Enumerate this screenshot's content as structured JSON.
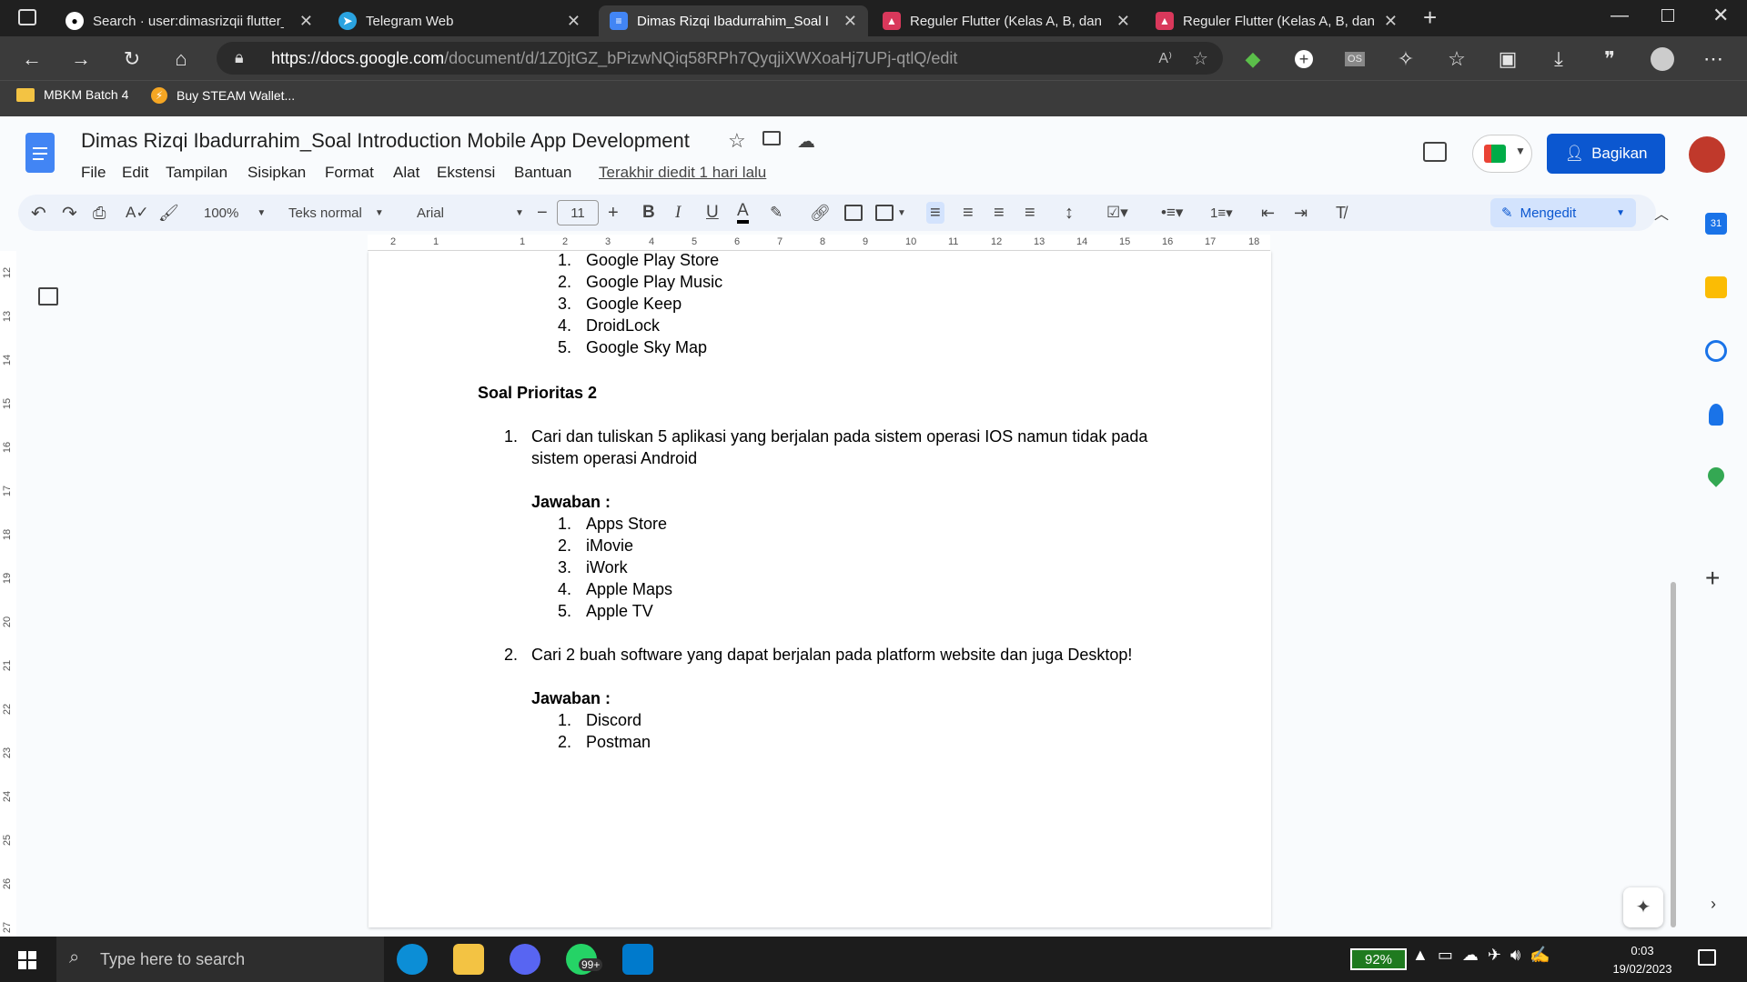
{
  "browser": {
    "tabs": [
      {
        "label": "Search · user:dimasrizqii flutter_n",
        "icon": "github-icon"
      },
      {
        "label": "Telegram Web",
        "icon": "telegram-icon"
      },
      {
        "label": "Dimas Rizqi Ibadurrahim_Soal Int",
        "icon": "docs-icon",
        "active": true
      },
      {
        "label": "Reguler Flutter (Kelas A, B, dan C",
        "icon": "forms-icon"
      },
      {
        "label": "Reguler Flutter (Kelas A, B, dan C",
        "icon": "forms-icon"
      }
    ],
    "url_domain": "https://docs.google.com",
    "url_path": "/document/d/1Z0jtGZ_bPizwNQiq58RPh7QyqjiXWXoaHj7UPj-qtlQ/edit",
    "bookmarks": [
      "MBKM Batch 4",
      "Buy STEAM Wallet..."
    ]
  },
  "doc": {
    "title": "Dimas Rizqi Ibadurrahim_Soal Introduction Mobile App Development",
    "menus": [
      "File",
      "Edit",
      "Tampilan",
      "Sisipkan",
      "Format",
      "Alat",
      "Ekstensi",
      "Bantuan"
    ],
    "last_edit": "Terakhir diedit 1 hari lalu",
    "share": "Bagikan",
    "zoom": "100%",
    "style": "Teks normal",
    "font": "Arial",
    "font_size": "11",
    "mode": "Mengedit"
  },
  "ruler_h": [
    "2",
    "1",
    "1",
    "2",
    "3",
    "4",
    "5",
    "6",
    "7",
    "8",
    "9",
    "10",
    "11",
    "12",
    "13",
    "14",
    "15",
    "16",
    "17",
    "18"
  ],
  "ruler_v": [
    "12",
    "13",
    "14",
    "15",
    "16",
    "17",
    "18",
    "19",
    "20",
    "21",
    "22",
    "23",
    "24",
    "25",
    "26",
    "27"
  ],
  "content": {
    "list1": [
      {
        "n": "1.",
        "t": "Google Play Store"
      },
      {
        "n": "2.",
        "t": "Google Play Music"
      },
      {
        "n": "3.",
        "t": "Google Keep"
      },
      {
        "n": "4.",
        "t": "DroidLock"
      },
      {
        "n": "5.",
        "t": "Google Sky Map"
      }
    ],
    "heading": "Soal Prioritas 2",
    "q1_num": "1.",
    "q1_line1": "Cari dan tuliskan 5 aplikasi yang berjalan pada sistem operasi IOS namun tidak pada",
    "q1_line2": "sistem operasi Android",
    "answer_label": "Jawaban :",
    "list2": [
      {
        "n": "1.",
        "t": "Apps Store"
      },
      {
        "n": "2.",
        "t": "iMovie"
      },
      {
        "n": "3.",
        "t": "iWork"
      },
      {
        "n": "4.",
        "t": "Apple Maps"
      },
      {
        "n": "5.",
        "t": "Apple TV"
      }
    ],
    "q2_num": "2.",
    "q2_text": "Cari 2 buah software yang dapat berjalan pada platform website dan juga Desktop!",
    "answer_label2": "Jawaban :",
    "list3": [
      {
        "n": "1.",
        "t": "Discord"
      },
      {
        "n": "2.",
        "t": "Postman"
      }
    ]
  },
  "taskbar": {
    "search_placeholder": "Type here to search",
    "whatsapp_badge": "99+",
    "battery": "92%",
    "time": "0:03",
    "date": "19/02/2023"
  }
}
